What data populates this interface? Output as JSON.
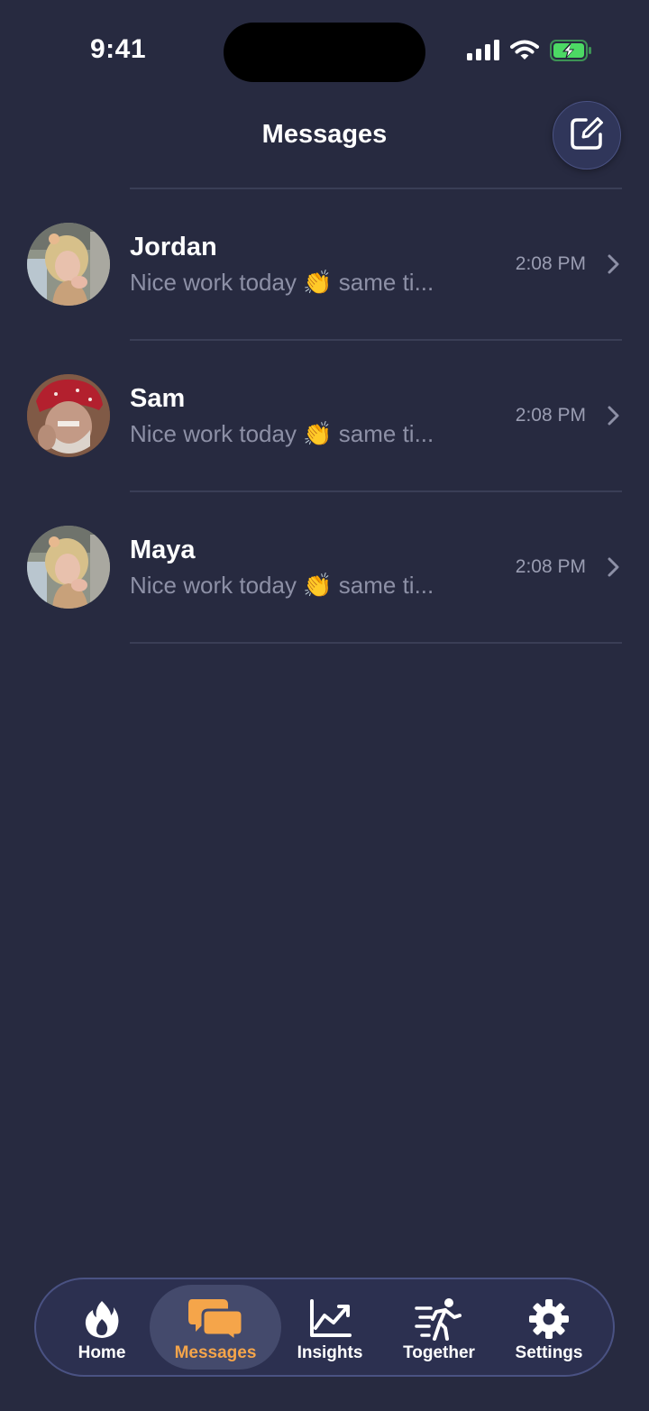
{
  "status_bar": {
    "time": "9:41",
    "icons": [
      "cellular-signal-icon",
      "wifi-icon",
      "battery-charging-icon"
    ]
  },
  "header": {
    "title": "Messages",
    "compose_icon": "compose-icon"
  },
  "conversations": [
    {
      "name": "Jordan",
      "preview": "Nice work today 👏 same ti...",
      "time": "2:08 PM",
      "avatar": "avatar-woman-blonde"
    },
    {
      "name": "Sam",
      "preview": "Nice work today 👏 same ti...",
      "time": "2:08 PM",
      "avatar": "avatar-man-bandana"
    },
    {
      "name": "Maya",
      "preview": "Nice work today 👏 same ti...",
      "time": "2:08 PM",
      "avatar": "avatar-woman-blonde"
    }
  ],
  "tab_bar": {
    "tabs": [
      {
        "label": "Home",
        "icon": "flame-icon",
        "active": false
      },
      {
        "label": "Messages",
        "icon": "chat-bubbles-icon",
        "active": true
      },
      {
        "label": "Insights",
        "icon": "trend-chart-icon",
        "active": false
      },
      {
        "label": "Together",
        "icon": "walking-person-icon",
        "active": false
      },
      {
        "label": "Settings",
        "icon": "gear-icon",
        "active": false
      }
    ]
  },
  "colors": {
    "background": "#272a40",
    "accent": "#f5a54a",
    "battery": "#4cd964",
    "secondary_text": "#8d90a6"
  }
}
